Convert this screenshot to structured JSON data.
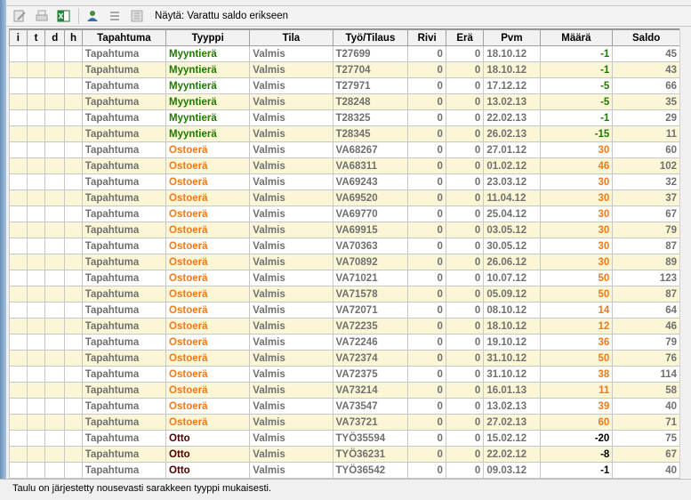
{
  "toolbar": {
    "icons": [
      "edit-icon",
      "print-icon",
      "excel-export-icon",
      "users-icon",
      "list-icon",
      "calculator-icon"
    ],
    "view_label": "Näytä: Varattu saldo erikseen"
  },
  "table": {
    "columns": [
      "i",
      "t",
      "d",
      "h",
      "Tapahtuma",
      "Tyyppi",
      "Tila",
      "Työ/Tilaus",
      "Rivi",
      "Erä",
      "Pvm",
      "Määrä",
      "Saldo"
    ],
    "rows": [
      [
        "",
        "",
        "",
        "",
        "Tapahtuma",
        "Myyntierä",
        "Valmis",
        "T27699",
        "0",
        "0",
        "18.10.12",
        "-1",
        "45"
      ],
      [
        "",
        "",
        "",
        "",
        "Tapahtuma",
        "Myyntierä",
        "Valmis",
        "T27704",
        "0",
        "0",
        "18.10.12",
        "-1",
        "43"
      ],
      [
        "",
        "",
        "",
        "",
        "Tapahtuma",
        "Myyntierä",
        "Valmis",
        "T27971",
        "0",
        "0",
        "17.12.12",
        "-5",
        "66"
      ],
      [
        "",
        "",
        "",
        "",
        "Tapahtuma",
        "Myyntierä",
        "Valmis",
        "T28248",
        "0",
        "0",
        "13.02.13",
        "-5",
        "35"
      ],
      [
        "",
        "",
        "",
        "",
        "Tapahtuma",
        "Myyntierä",
        "Valmis",
        "T28325",
        "0",
        "0",
        "22.02.13",
        "-1",
        "29"
      ],
      [
        "",
        "",
        "",
        "",
        "Tapahtuma",
        "Myyntierä",
        "Valmis",
        "T28345",
        "0",
        "0",
        "26.02.13",
        "-15",
        "11"
      ],
      [
        "",
        "",
        "",
        "",
        "Tapahtuma",
        "Ostoerä",
        "Valmis",
        "VA68267",
        "0",
        "0",
        "27.01.12",
        "30",
        "60"
      ],
      [
        "",
        "",
        "",
        "",
        "Tapahtuma",
        "Ostoerä",
        "Valmis",
        "VA68311",
        "0",
        "0",
        "01.02.12",
        "46",
        "102"
      ],
      [
        "",
        "",
        "",
        "",
        "Tapahtuma",
        "Ostoerä",
        "Valmis",
        "VA69243",
        "0",
        "0",
        "23.03.12",
        "30",
        "32"
      ],
      [
        "",
        "",
        "",
        "",
        "Tapahtuma",
        "Ostoerä",
        "Valmis",
        "VA69520",
        "0",
        "0",
        "11.04.12",
        "30",
        "37"
      ],
      [
        "",
        "",
        "",
        "",
        "Tapahtuma",
        "Ostoerä",
        "Valmis",
        "VA69770",
        "0",
        "0",
        "25.04.12",
        "30",
        "67"
      ],
      [
        "",
        "",
        "",
        "",
        "Tapahtuma",
        "Ostoerä",
        "Valmis",
        "VA69915",
        "0",
        "0",
        "03.05.12",
        "30",
        "79"
      ],
      [
        "",
        "",
        "",
        "",
        "Tapahtuma",
        "Ostoerä",
        "Valmis",
        "VA70363",
        "0",
        "0",
        "30.05.12",
        "30",
        "87"
      ],
      [
        "",
        "",
        "",
        "",
        "Tapahtuma",
        "Ostoerä",
        "Valmis",
        "VA70892",
        "0",
        "0",
        "26.06.12",
        "30",
        "89"
      ],
      [
        "",
        "",
        "",
        "",
        "Tapahtuma",
        "Ostoerä",
        "Valmis",
        "VA71021",
        "0",
        "0",
        "10.07.12",
        "50",
        "123"
      ],
      [
        "",
        "",
        "",
        "",
        "Tapahtuma",
        "Ostoerä",
        "Valmis",
        "VA71578",
        "0",
        "0",
        "05.09.12",
        "50",
        "87"
      ],
      [
        "",
        "",
        "",
        "",
        "Tapahtuma",
        "Ostoerä",
        "Valmis",
        "VA72071",
        "0",
        "0",
        "08.10.12",
        "14",
        "64"
      ],
      [
        "",
        "",
        "",
        "",
        "Tapahtuma",
        "Ostoerä",
        "Valmis",
        "VA72235",
        "0",
        "0",
        "18.10.12",
        "12",
        "46"
      ],
      [
        "",
        "",
        "",
        "",
        "Tapahtuma",
        "Ostoerä",
        "Valmis",
        "VA72246",
        "0",
        "0",
        "19.10.12",
        "36",
        "79"
      ],
      [
        "",
        "",
        "",
        "",
        "Tapahtuma",
        "Ostoerä",
        "Valmis",
        "VA72374",
        "0",
        "0",
        "31.10.12",
        "50",
        "76"
      ],
      [
        "",
        "",
        "",
        "",
        "Tapahtuma",
        "Ostoerä",
        "Valmis",
        "VA72375",
        "0",
        "0",
        "31.10.12",
        "38",
        "114"
      ],
      [
        "",
        "",
        "",
        "",
        "Tapahtuma",
        "Ostoerä",
        "Valmis",
        "VA73214",
        "0",
        "0",
        "16.01.13",
        "11",
        "58"
      ],
      [
        "",
        "",
        "",
        "",
        "Tapahtuma",
        "Ostoerä",
        "Valmis",
        "VA73547",
        "0",
        "0",
        "13.02.13",
        "39",
        "40"
      ],
      [
        "",
        "",
        "",
        "",
        "Tapahtuma",
        "Ostoerä",
        "Valmis",
        "VA73721",
        "0",
        "0",
        "27.02.13",
        "60",
        "71"
      ],
      [
        "",
        "",
        "",
        "",
        "Tapahtuma",
        "Otto",
        "Valmis",
        "TYÖ35594",
        "0",
        "0",
        "15.02.12",
        "-20",
        "75"
      ],
      [
        "",
        "",
        "",
        "",
        "Tapahtuma",
        "Otto",
        "Valmis",
        "TYÖ36231",
        "0",
        "0",
        "22.02.12",
        "-8",
        "67"
      ],
      [
        "",
        "",
        "",
        "",
        "Tapahtuma",
        "Otto",
        "Valmis",
        "TYÖ36542",
        "0",
        "0",
        "09.03.12",
        "-1",
        "40"
      ]
    ]
  },
  "type_colors": {
    "Myyntierä": "#1f7a00",
    "Ostoerä": "#f07a1a",
    "Otto": "#4a0000"
  },
  "status": {
    "text": "Taulu on järjestetty nousevasti sarakkeen tyyppi mukaisesti."
  }
}
